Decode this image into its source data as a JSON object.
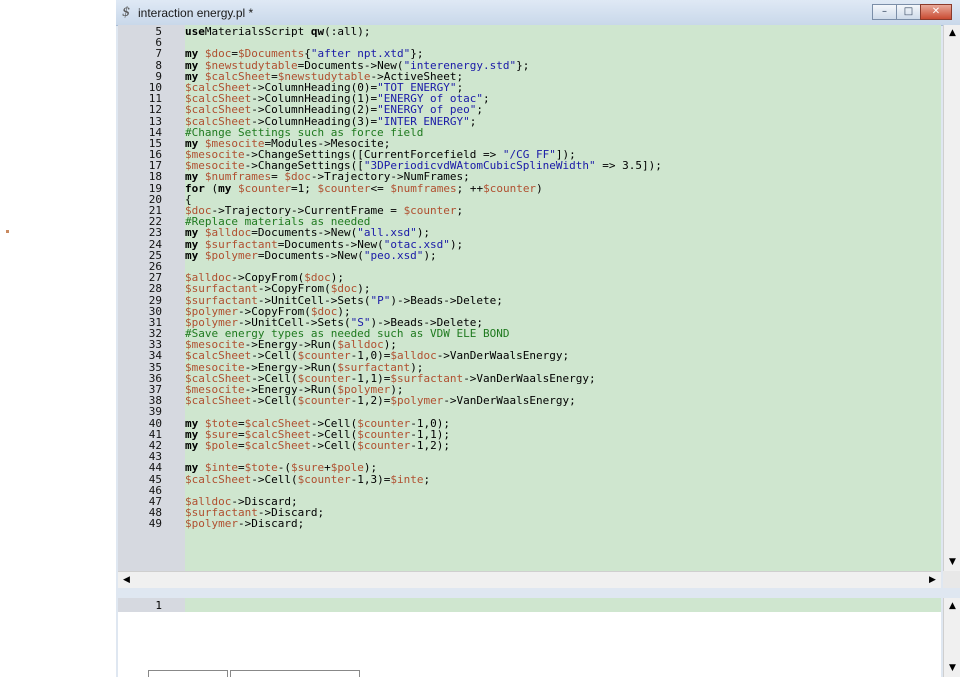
{
  "window": {
    "icon": "script-icon",
    "title": "interaction energy.pl *",
    "minimize_label": "–",
    "maximize_label": "□",
    "close_label": "✕"
  },
  "editor": {
    "lines": [
      {
        "n": "5",
        "t": [
          [
            "kw",
            "use"
          ],
          [
            "",
            "MaterialsScript "
          ],
          [
            "kw",
            "qw"
          ],
          [
            "",
            "(:all);"
          ]
        ]
      },
      {
        "n": "6",
        "t": []
      },
      {
        "n": "7",
        "t": [
          [
            "kw",
            "my "
          ],
          [
            "vr",
            "$doc"
          ],
          [
            "",
            "="
          ],
          [
            "vr",
            "$Documents"
          ],
          [
            "",
            "{"
          ],
          [
            "st",
            "\"after npt.xtd\""
          ],
          [
            "",
            "};"
          ]
        ]
      },
      {
        "n": "8",
        "t": [
          [
            "kw",
            "my "
          ],
          [
            "vr",
            "$newstudytable"
          ],
          [
            "",
            "=Documents->New("
          ],
          [
            "st",
            "\"interenergy.std\""
          ],
          [
            "",
            "};"
          ]
        ]
      },
      {
        "n": "9",
        "t": [
          [
            "kw",
            "my "
          ],
          [
            "vr",
            "$calcSheet"
          ],
          [
            "",
            "="
          ],
          [
            "vr",
            "$newstudytable"
          ],
          [
            "",
            "->ActiveSheet;"
          ]
        ]
      },
      {
        "n": "10",
        "t": [
          [
            "vr",
            "$calcSheet"
          ],
          [
            "",
            "->ColumnHeading(0)="
          ],
          [
            "st",
            "\"TOT ENERGY\""
          ],
          [
            "",
            ";"
          ]
        ]
      },
      {
        "n": "11",
        "t": [
          [
            "vr",
            "$calcSheet"
          ],
          [
            "",
            "->ColumnHeading(1)="
          ],
          [
            "st",
            "\"ENERGY of otac\""
          ],
          [
            "",
            ";"
          ]
        ]
      },
      {
        "n": "12",
        "t": [
          [
            "vr",
            "$calcSheet"
          ],
          [
            "",
            "->ColumnHeading(2)="
          ],
          [
            "st",
            "\"ENERGY of peo\""
          ],
          [
            "",
            ";"
          ]
        ]
      },
      {
        "n": "13",
        "t": [
          [
            "vr",
            "$calcSheet"
          ],
          [
            "",
            "->ColumnHeading(3)="
          ],
          [
            "st",
            "\"INTER ENERGY\""
          ],
          [
            "",
            ";"
          ]
        ]
      },
      {
        "n": "14",
        "t": [
          [
            "cm",
            "#Change Settings such as force field"
          ]
        ]
      },
      {
        "n": "15",
        "t": [
          [
            "kw",
            "my "
          ],
          [
            "vr",
            "$mesocite"
          ],
          [
            "",
            "=Modules->Mesocite;"
          ]
        ]
      },
      {
        "n": "16",
        "t": [
          [
            "vr",
            "$mesocite"
          ],
          [
            "",
            "->ChangeSettings([CurrentForcefield => "
          ],
          [
            "st",
            "\"/CG FF\""
          ],
          [
            "",
            "]);"
          ]
        ]
      },
      {
        "n": "17",
        "t": [
          [
            "vr",
            "$mesocite"
          ],
          [
            "",
            "->ChangeSettings(["
          ],
          [
            "st",
            "\"3DPeriodicvdWAtomCubicSplineWidth\""
          ],
          [
            "",
            " => 3.5]);"
          ]
        ]
      },
      {
        "n": "18",
        "t": [
          [
            "kw",
            "my "
          ],
          [
            "vr",
            "$numframes"
          ],
          [
            "",
            "= "
          ],
          [
            "vr",
            "$doc"
          ],
          [
            "",
            "->Trajectory->NumFrames;"
          ]
        ]
      },
      {
        "n": "19",
        "t": [
          [
            "kw",
            "for "
          ],
          [
            "",
            "("
          ],
          [
            "kw",
            "my "
          ],
          [
            "vr",
            "$counter"
          ],
          [
            "",
            "=1; "
          ],
          [
            "vr",
            "$counter"
          ],
          [
            "",
            "<= "
          ],
          [
            "vr",
            "$numframes"
          ],
          [
            "",
            "; ++"
          ],
          [
            "vr",
            "$counter"
          ],
          [
            "",
            ")"
          ]
        ]
      },
      {
        "n": "20",
        "t": [
          [
            "",
            "{"
          ]
        ]
      },
      {
        "n": "21",
        "t": [
          [
            "vr",
            "$doc"
          ],
          [
            "",
            "->Trajectory->CurrentFrame = "
          ],
          [
            "vr",
            "$counter"
          ],
          [
            "",
            ";"
          ]
        ]
      },
      {
        "n": "22",
        "t": [
          [
            "cm",
            "#Replace materials as needed"
          ]
        ]
      },
      {
        "n": "23",
        "t": [
          [
            "kw",
            "my "
          ],
          [
            "vr",
            "$alldoc"
          ],
          [
            "",
            "=Documents->New("
          ],
          [
            "st",
            "\"all.xsd\""
          ],
          [
            "",
            ");"
          ]
        ]
      },
      {
        "n": "24",
        "t": [
          [
            "kw",
            "my "
          ],
          [
            "vr",
            "$surfactant"
          ],
          [
            "",
            "=Documents->New("
          ],
          [
            "st",
            "\"otac.xsd\""
          ],
          [
            "",
            ");"
          ]
        ]
      },
      {
        "n": "25",
        "t": [
          [
            "kw",
            "my "
          ],
          [
            "vr",
            "$polymer"
          ],
          [
            "",
            "=Documents->New("
          ],
          [
            "st",
            "\"peo.xsd\""
          ],
          [
            "",
            ");"
          ]
        ]
      },
      {
        "n": "26",
        "t": []
      },
      {
        "n": "27",
        "t": [
          [
            "vr",
            "$alldoc"
          ],
          [
            "",
            "->CopyFrom("
          ],
          [
            "vr",
            "$doc"
          ],
          [
            "",
            ");"
          ]
        ]
      },
      {
        "n": "28",
        "t": [
          [
            "vr",
            "$surfactant"
          ],
          [
            "",
            "->CopyFrom("
          ],
          [
            "vr",
            "$doc"
          ],
          [
            "",
            ");"
          ]
        ]
      },
      {
        "n": "29",
        "t": [
          [
            "vr",
            "$surfactant"
          ],
          [
            "",
            "->UnitCell->Sets("
          ],
          [
            "st",
            "\"P\""
          ],
          [
            "",
            ")->Beads->Delete;"
          ]
        ]
      },
      {
        "n": "30",
        "t": [
          [
            "vr",
            "$polymer"
          ],
          [
            "",
            "->CopyFrom("
          ],
          [
            "vr",
            "$doc"
          ],
          [
            "",
            ");"
          ]
        ]
      },
      {
        "n": "31",
        "t": [
          [
            "vr",
            "$polymer"
          ],
          [
            "",
            "->UnitCell->Sets("
          ],
          [
            "st",
            "\"S\""
          ],
          [
            "",
            ")->Beads->Delete;"
          ]
        ]
      },
      {
        "n": "32",
        "t": [
          [
            "cm",
            "#Save energy types as needed such as VDW ELE BOND"
          ]
        ]
      },
      {
        "n": "33",
        "t": [
          [
            "vr",
            "$mesocite"
          ],
          [
            "",
            "->Energy->Run("
          ],
          [
            "vr",
            "$alldoc"
          ],
          [
            "",
            ");"
          ]
        ]
      },
      {
        "n": "34",
        "t": [
          [
            "vr",
            "$calcSheet"
          ],
          [
            "",
            "->Cell("
          ],
          [
            "vr",
            "$counter"
          ],
          [
            "",
            "-1,0)="
          ],
          [
            "vr",
            "$alldoc"
          ],
          [
            "",
            "->VanDerWaalsEnergy;"
          ]
        ]
      },
      {
        "n": "35",
        "t": [
          [
            "vr",
            "$mesocite"
          ],
          [
            "",
            "->Energy->Run("
          ],
          [
            "vr",
            "$surfactant"
          ],
          [
            "",
            ");"
          ]
        ]
      },
      {
        "n": "36",
        "t": [
          [
            "vr",
            "$calcSheet"
          ],
          [
            "",
            "->Cell("
          ],
          [
            "vr",
            "$counter"
          ],
          [
            "",
            "-1,1)="
          ],
          [
            "vr",
            "$surfactant"
          ],
          [
            "",
            "->VanDerWaalsEnergy;"
          ]
        ]
      },
      {
        "n": "37",
        "t": [
          [
            "vr",
            "$mesocite"
          ],
          [
            "",
            "->Energy->Run("
          ],
          [
            "vr",
            "$polymer"
          ],
          [
            "",
            ");"
          ]
        ]
      },
      {
        "n": "38",
        "t": [
          [
            "vr",
            "$calcSheet"
          ],
          [
            "",
            "->Cell("
          ],
          [
            "vr",
            "$counter"
          ],
          [
            "",
            "-1,2)="
          ],
          [
            "vr",
            "$polymer"
          ],
          [
            "",
            "->VanDerWaalsEnergy;"
          ]
        ]
      },
      {
        "n": "39",
        "t": []
      },
      {
        "n": "40",
        "t": [
          [
            "kw",
            "my "
          ],
          [
            "vr",
            "$tote"
          ],
          [
            "",
            "="
          ],
          [
            "vr",
            "$calcSheet"
          ],
          [
            "",
            "->Cell("
          ],
          [
            "vr",
            "$counter"
          ],
          [
            "",
            "-1,0);"
          ]
        ]
      },
      {
        "n": "41",
        "t": [
          [
            "kw",
            "my "
          ],
          [
            "vr",
            "$sure"
          ],
          [
            "",
            "="
          ],
          [
            "vr",
            "$calcSheet"
          ],
          [
            "",
            "->Cell("
          ],
          [
            "vr",
            "$counter"
          ],
          [
            "",
            "-1,1);"
          ]
        ]
      },
      {
        "n": "42",
        "t": [
          [
            "kw",
            "my "
          ],
          [
            "vr",
            "$pole"
          ],
          [
            "",
            "="
          ],
          [
            "vr",
            "$calcSheet"
          ],
          [
            "",
            "->Cell("
          ],
          [
            "vr",
            "$counter"
          ],
          [
            "",
            "-1,2);"
          ]
        ]
      },
      {
        "n": "43",
        "t": []
      },
      {
        "n": "44",
        "t": [
          [
            "kw",
            "my "
          ],
          [
            "vr",
            "$inte"
          ],
          [
            "",
            "="
          ],
          [
            "vr",
            "$tote"
          ],
          [
            "",
            "-("
          ],
          [
            "vr",
            "$sure"
          ],
          [
            "",
            "+"
          ],
          [
            "vr",
            "$pole"
          ],
          [
            "",
            ");"
          ]
        ]
      },
      {
        "n": "45",
        "t": [
          [
            "vr",
            "$calcSheet"
          ],
          [
            "",
            "->Cell("
          ],
          [
            "vr",
            "$counter"
          ],
          [
            "",
            "-1,3)="
          ],
          [
            "vr",
            "$inte"
          ],
          [
            "",
            ";"
          ]
        ]
      },
      {
        "n": "46",
        "t": []
      },
      {
        "n": "47",
        "t": [
          [
            "vr",
            "$alldoc"
          ],
          [
            "",
            "->Discard;"
          ]
        ]
      },
      {
        "n": "48",
        "t": [
          [
            "vr",
            "$surfactant"
          ],
          [
            "",
            "->Discard;"
          ]
        ]
      },
      {
        "n": "49",
        "t": [
          [
            "vr",
            "$polymer"
          ],
          [
            "",
            "->Discard;"
          ]
        ]
      }
    ]
  },
  "output_pane": {
    "line_number": "1"
  },
  "scroll": {
    "up": "▲",
    "down": "▼",
    "left": "◀",
    "right": "▶"
  },
  "colors": {
    "editor_bg": "#cfe6cf",
    "keyword": "#000000",
    "variable": "#b05030",
    "string": "#1a1aa8",
    "comment": "#1f7a1f"
  }
}
